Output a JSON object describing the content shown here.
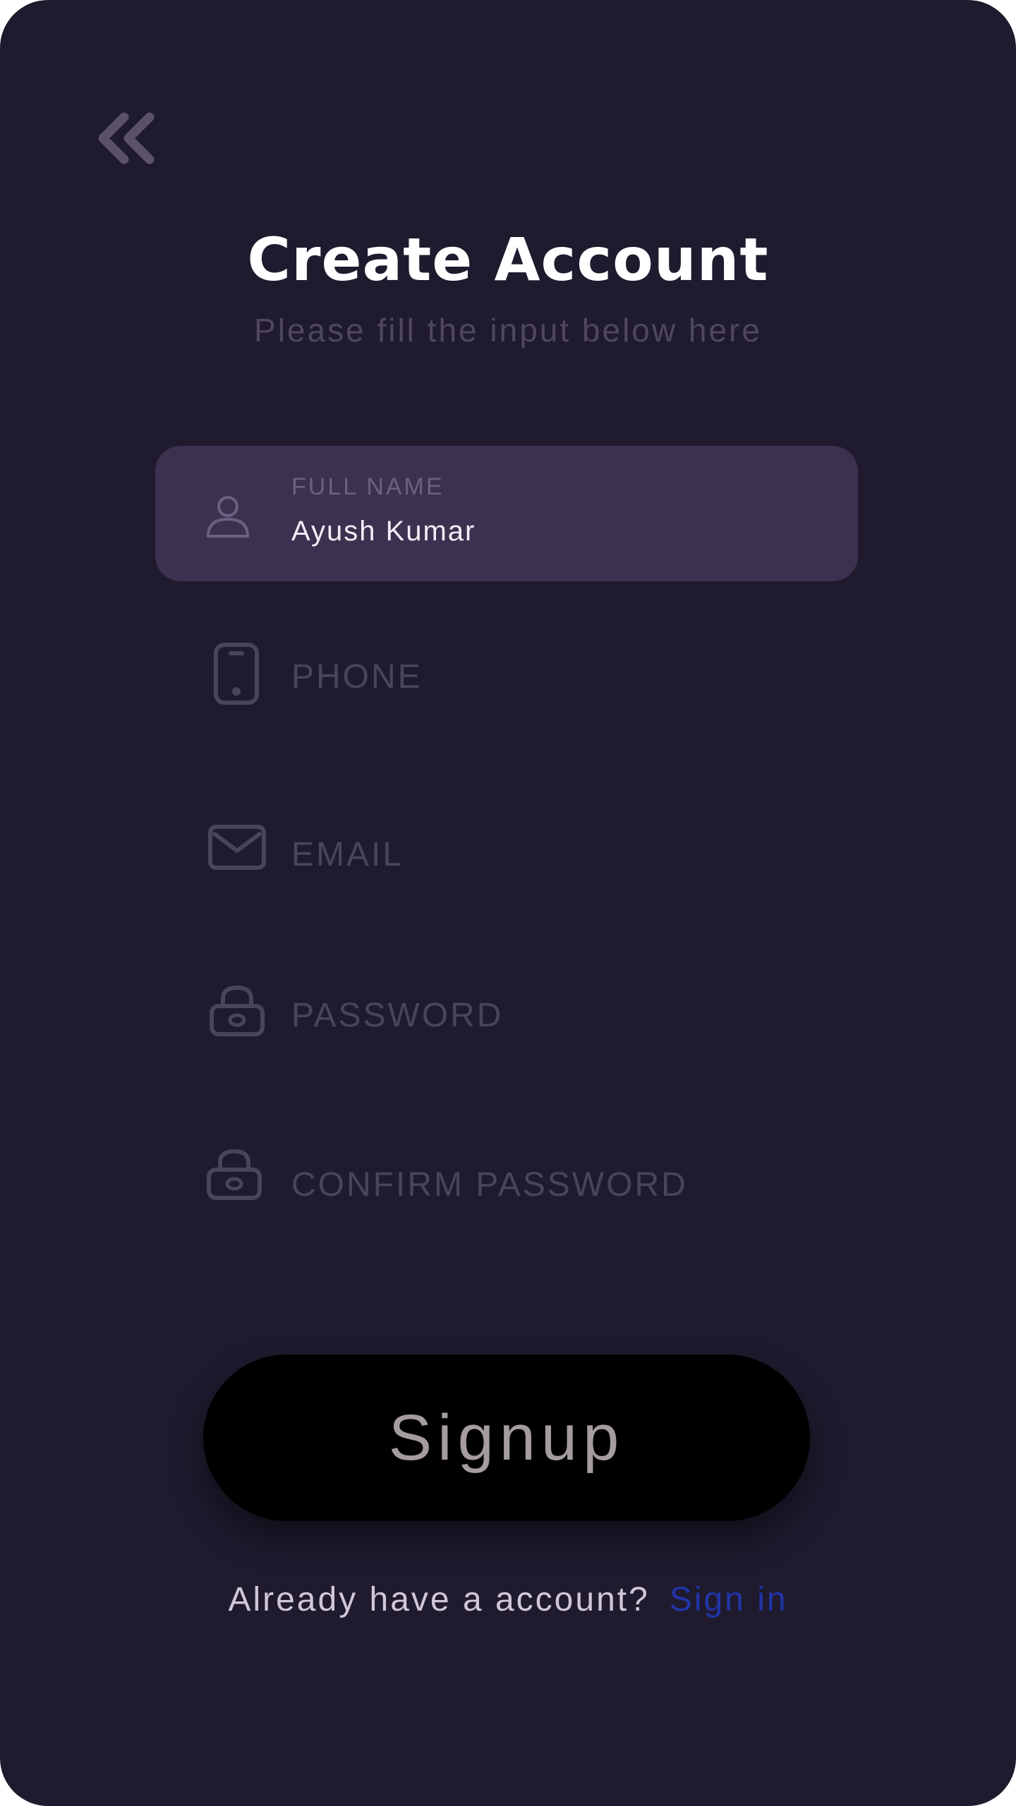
{
  "header": {
    "back_icon": "double-chevron-left-icon",
    "title": "Create Account",
    "subtitle": "Please fill the input below here"
  },
  "form": {
    "full_name": {
      "icon": "user-icon",
      "label": "FULL NAME",
      "value": "Ayush Kumar"
    },
    "phone": {
      "icon": "phone-icon",
      "label": "PHONE"
    },
    "email": {
      "icon": "mail-icon",
      "label": "EMAIL"
    },
    "password": {
      "icon": "lock-icon",
      "label": "PASSWORD"
    },
    "confirm_password": {
      "icon": "lock-icon",
      "label": "CONFIRM PASSWORD"
    }
  },
  "signup_button": {
    "label": "Signup"
  },
  "footer": {
    "question": "Already have a account?",
    "link": "Sign in"
  },
  "colors": {
    "background": "#1f1a2e",
    "active_field": "#3d3150",
    "button_bg": "#000000",
    "button_text": "#a49c9f",
    "link": "#2135a8",
    "muted": "#4a4459"
  }
}
